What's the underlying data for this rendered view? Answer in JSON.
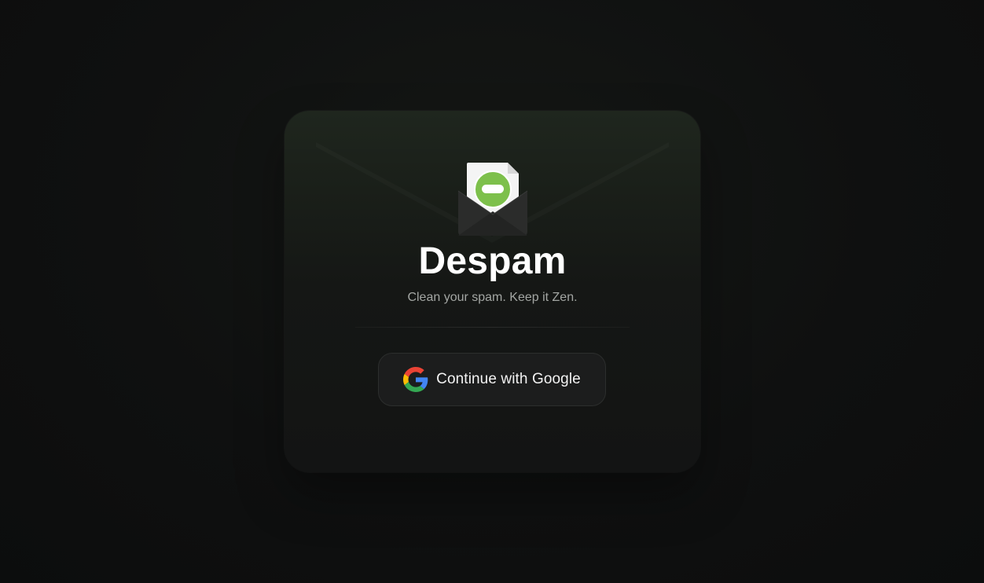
{
  "app": {
    "name": "Despam",
    "tagline": "Clean your spam. Keep it Zen."
  },
  "auth": {
    "google_button_label": "Continue with Google"
  },
  "icons": {
    "logo": "envelope-blocked-icon",
    "google": "google-g-icon"
  },
  "colors": {
    "page_background": "#0e0f0f",
    "card_background_top": "#1f261e",
    "card_background_bottom": "#131414",
    "brand_green": "#7dc04b",
    "title_text": "#ffffff",
    "muted_text": "#a3a6a3",
    "button_background": "#1c1d1d"
  }
}
